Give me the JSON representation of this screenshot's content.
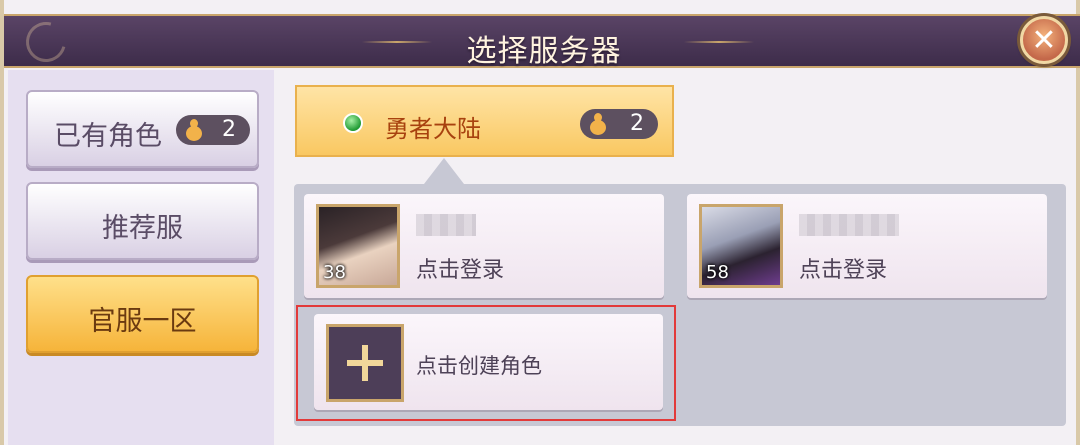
{
  "header": {
    "title": "选择服务器",
    "close_icon": "close-icon"
  },
  "sidebar": {
    "items": [
      {
        "label": "已有角色",
        "count": "2",
        "active": false
      },
      {
        "label": "推荐服",
        "active": false
      },
      {
        "label": "官服一区",
        "active": true
      }
    ]
  },
  "server": {
    "name": "勇者大陆",
    "count": "2",
    "status": "online",
    "status_color": "#1f9a33"
  },
  "characters": [
    {
      "level": "38",
      "action": "点击登录"
    },
    {
      "level": "58",
      "action": "点击登录"
    }
  ],
  "create": {
    "label": "点击创建角色",
    "icon": "plus-icon"
  },
  "colors": {
    "accent": "#f6b43a",
    "title_bar": "#3d2c4a",
    "highlight": "#e23a3a"
  }
}
